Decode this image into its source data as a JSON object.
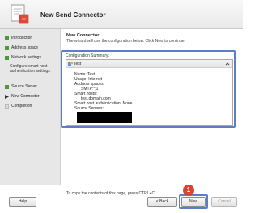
{
  "window": {
    "title": "New Send Connector"
  },
  "sidebar": {
    "items": [
      {
        "label": "Introduction",
        "state": "done"
      },
      {
        "label": "Address space",
        "state": "done"
      },
      {
        "label": "Network settings",
        "state": "done"
      },
      {
        "label": "Source Server",
        "state": "done"
      },
      {
        "label": "New Connector",
        "state": "current"
      },
      {
        "label": "Completion",
        "state": "pending"
      }
    ],
    "sub_item": {
      "label": "Configure smart host authentication settings"
    }
  },
  "main": {
    "section_title": "New Connector",
    "description": "The wizard will use the configuration below.  Click New to continue.",
    "summary_label": "Configuration Summary:",
    "summary": {
      "name": "Test",
      "lines": [
        "Name: Test",
        "Usage: Internet",
        "Address spaces:",
        "SMTP:*;1",
        "Smart hosts:",
        "test.domain.com",
        "Smart host authentication: None",
        "Source Servers:"
      ]
    },
    "copy_hint": "To copy the contents of this page, press CTRL+C."
  },
  "buttons": {
    "help": "Help",
    "back": "< Back",
    "next": "New",
    "cancel": "Cancel"
  },
  "annotation": {
    "badge": "1"
  },
  "colors": {
    "highlight": "#5b7fc7",
    "badge": "#d9452f",
    "sidebar_bg": "#e7e7e7",
    "done_icon": "#4a9a3a"
  }
}
